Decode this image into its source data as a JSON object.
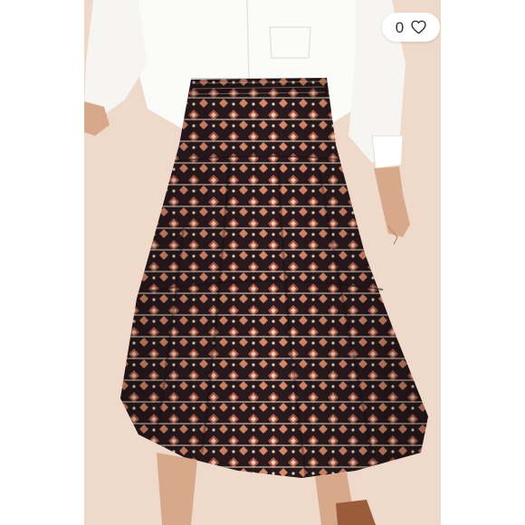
{
  "listing": {
    "image": {
      "subject": "product-photo",
      "colors": {
        "background": "#efd9cb",
        "shirt": "#fbfbf9",
        "skirt_base": "#2a1a1e",
        "pattern_rust": "#b85a45",
        "pattern_cream": "#e7d8c4",
        "skin": "#d7a98a",
        "shoe": "#9a5c3a"
      }
    },
    "like": {
      "count": "0",
      "icon": "heart-outline-icon"
    }
  }
}
